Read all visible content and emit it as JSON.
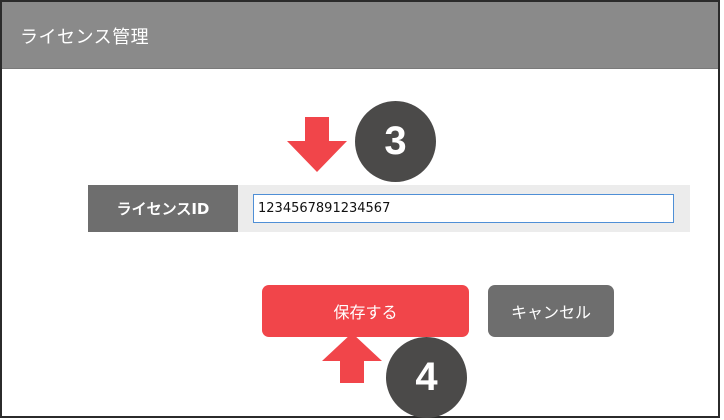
{
  "dialog": {
    "title": "ライセンス管理"
  },
  "license_field": {
    "label": "ライセンスID",
    "value": "1234567891234567"
  },
  "buttons": {
    "save_label": "保存する",
    "cancel_label": "キャンセル"
  },
  "annotations": {
    "step3": "3",
    "step4": "4",
    "arrow_color": "#f1454a",
    "badge_color": "#4b4a49"
  },
  "colors": {
    "titlebar": "#8a8a8a",
    "label_bg": "#6e6e6e",
    "save": "#f1454a",
    "cancel": "#6e6e6e"
  }
}
